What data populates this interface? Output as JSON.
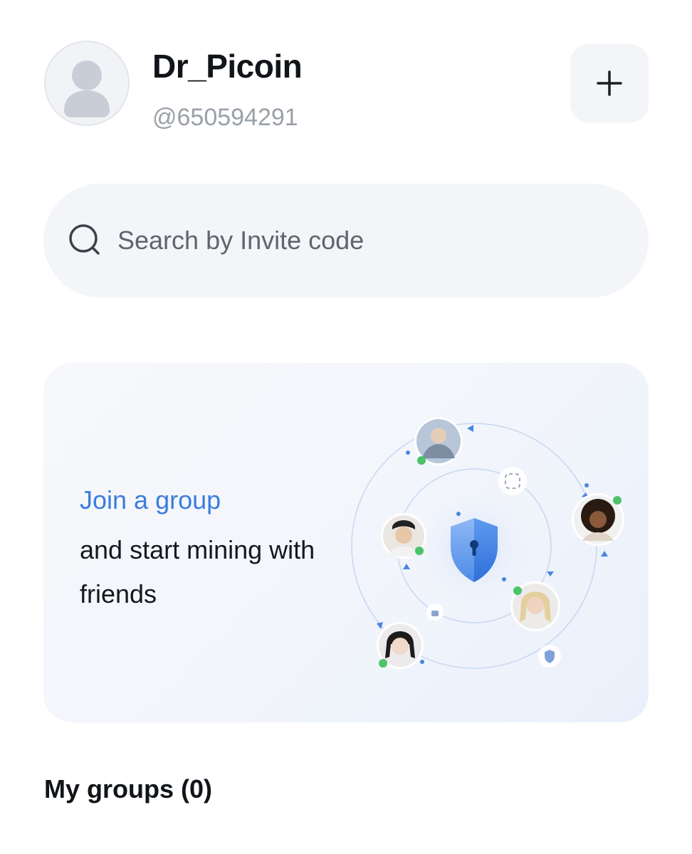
{
  "profile": {
    "name": "Dr_Picoin",
    "handle": "@650594291"
  },
  "actions": {
    "add_icon": "plus-icon"
  },
  "search": {
    "placeholder": "Search by Invite code",
    "icon": "search-icon"
  },
  "promo": {
    "title": "Join a group",
    "subtitle": "and start mining with friends",
    "accent_color": "#3b7ddd"
  },
  "groups": {
    "heading": "My groups (0)"
  }
}
